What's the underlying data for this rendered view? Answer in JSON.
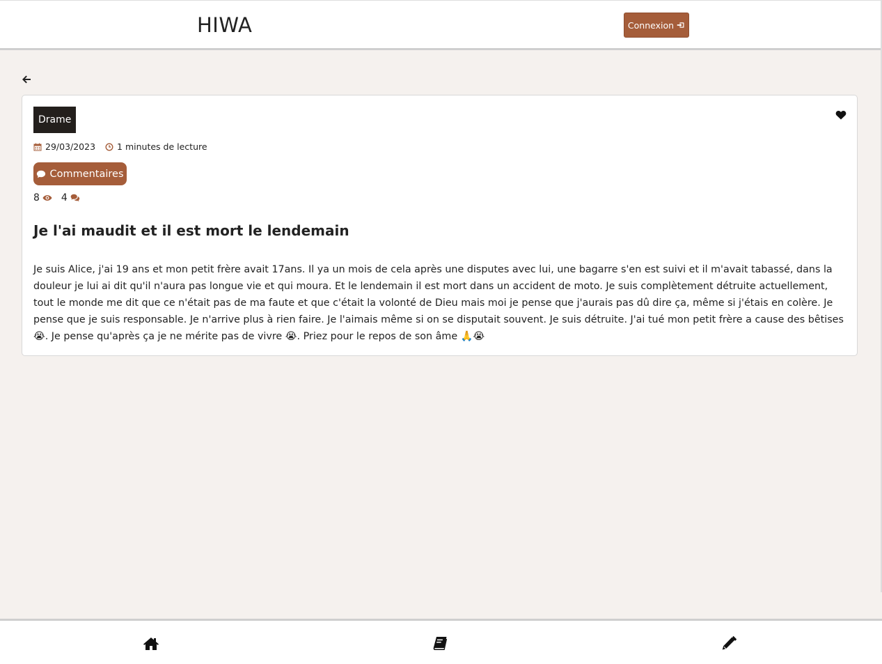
{
  "header": {
    "brand": "HIWA",
    "login_label": "Connexion"
  },
  "post": {
    "category": "Drame",
    "date": "29/03/2023",
    "reading_time": "1 minutes de lecture",
    "comments_button": "Commentaires",
    "views": "8",
    "comments_count": "4",
    "title": "Je l'ai maudit et il est mort le lendemain",
    "body": "Je suis Alice, j'ai 19 ans et mon petit frère avait 17ans. Il ya un mois de cela après une disputes avec lui, une bagarre s'en est suivi et il m'avait tabassé, dans la douleur je lui ai dit qu'il n'aura pas longue vie et qui moura. Et le lendemain il est mort dans un accident de moto. Je suis complètement détruite actuellement, tout le monde me dit que ce n'était pas de ma faute et que c'était la volonté de Dieu mais moi je pense que j'aurais pas dû dire ça, même si j'étais en colère. Je pense que je suis responsable. Je n'arrive plus à rien faire. Je l'aimais même si on se disputait souvent. Je suis détruite. J'ai tué mon petit frère a cause des bêtises 😭. Je pense qu'après ça je ne mérite pas de vivre 😭. Priez pour le repos de son âme 🙏😭"
  },
  "colors": {
    "accent": "#a55d3a",
    "background": "#f5f1ee",
    "tag_background": "#231f1c"
  },
  "icons": {
    "back": "arrow-left-icon",
    "favorite": "heart-icon",
    "date": "calendar-icon",
    "time": "clock-icon",
    "comment": "comment-icon",
    "views": "eye-icon",
    "comments": "comments-icon",
    "nav_home": "home-icon",
    "nav_book": "book-icon",
    "nav_write": "pencil-icon"
  }
}
